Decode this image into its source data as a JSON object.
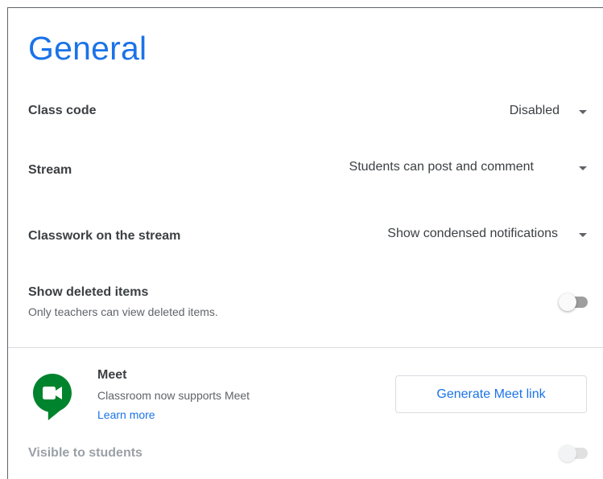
{
  "title": "General",
  "settings": {
    "class_code": {
      "label": "Class code",
      "value": "Disabled"
    },
    "stream": {
      "label": "Stream",
      "value": "Students can post and comment"
    },
    "classwork_on_stream": {
      "label": "Classwork on the stream",
      "value": "Show condensed notifications"
    },
    "show_deleted_items": {
      "label": "Show deleted items",
      "description": "Only teachers can view deleted items.",
      "enabled": false
    }
  },
  "meet": {
    "title": "Meet",
    "description": "Classroom now supports Meet",
    "learn_more": "Learn more",
    "generate_button": "Generate Meet link",
    "visible_to_students": {
      "label": "Visible to students",
      "enabled": false,
      "disabled": true
    },
    "logo_icon": "google-meet-icon",
    "colors": {
      "green": "#00832d",
      "accent": "#1a73e8"
    }
  }
}
